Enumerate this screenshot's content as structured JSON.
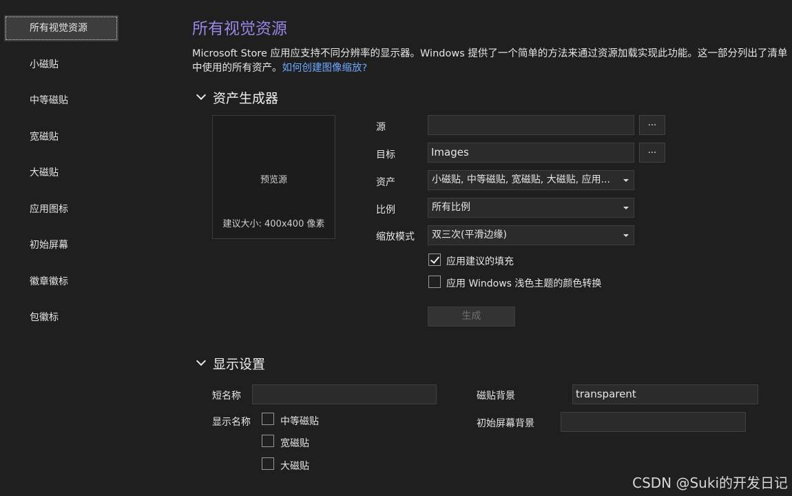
{
  "sidebar": {
    "items": [
      {
        "label": "所有视觉资源",
        "active": true
      },
      {
        "label": "小磁贴"
      },
      {
        "label": "中等磁贴"
      },
      {
        "label": "宽磁贴"
      },
      {
        "label": "大磁贴"
      },
      {
        "label": "应用图标"
      },
      {
        "label": "初始屏幕"
      },
      {
        "label": "徽章徽标"
      },
      {
        "label": "包徽标"
      }
    ]
  },
  "main": {
    "title": "所有视觉资源",
    "description": "Microsoft Store 应用应支持不同分辨率的显示器。Windows 提供了一个简单的方法来通过资源加载实现此功能。这一部分列出了清单中使用的所有资产。",
    "description_link": "如何创建图像缩放?",
    "asset_generator": {
      "heading": "资产生成器",
      "preview_label": "预览源",
      "preview_size_hint": "建议大小: 400x400 像素",
      "source_label": "源",
      "source_value": "",
      "browse_label": "...",
      "target_label": "目标",
      "target_value": "Images",
      "assets_label": "资产",
      "assets_value": "小磁贴, 中等磁贴, 宽磁贴, 大磁贴, 应用...",
      "scale_label": "比例",
      "scale_value": "所有比例",
      "padding_mode_label": "缩放模式",
      "padding_mode_value": "双三次(平滑边缘)",
      "apply_padding_label": "应用建议的填充",
      "apply_padding_checked": true,
      "apply_light_theme_label": "应用 Windows 浅色主题的颜色转换",
      "apply_light_theme_checked": false,
      "generate_label": "生成"
    },
    "display_settings": {
      "heading": "显示设置",
      "short_name_label": "短名称",
      "short_name_value": "",
      "show_name_label": "显示名称",
      "show_name_options": [
        {
          "label": "中等磁贴",
          "checked": false
        },
        {
          "label": "宽磁贴",
          "checked": false
        },
        {
          "label": "大磁贴",
          "checked": false
        }
      ],
      "tile_background_label": "磁贴背景",
      "tile_background_value": "transparent",
      "splash_background_label": "初始屏幕背景",
      "splash_background_value": ""
    }
  },
  "watermark": "CSDN @Suki的开发日记",
  "colors": {
    "background": "#1f1f1f",
    "title_accent": "#9b86e6",
    "link": "#6fa8ff"
  }
}
